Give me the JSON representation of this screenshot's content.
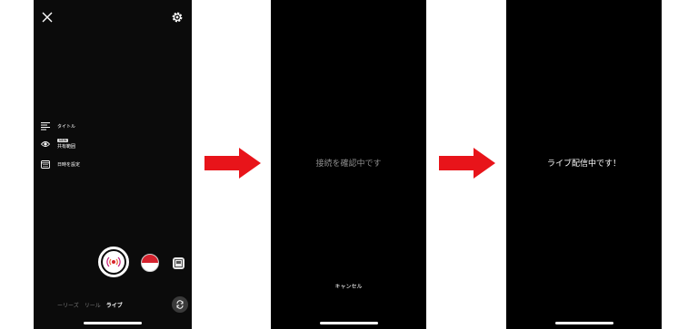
{
  "screen1": {
    "menu": {
      "title": "タイトル",
      "audience_badge": "NEW",
      "audience": "共有範囲",
      "schedule": "日時を設定"
    },
    "modes": [
      "ーリーズ",
      "リール",
      "ライブ"
    ],
    "active_mode": "ライブ",
    "icons": {
      "close": "close-icon",
      "settings": "gear-icon",
      "title": "text-lines-icon",
      "audience": "eye-icon",
      "schedule": "calendar-icon",
      "live": "broadcast-icon",
      "camera_switch": "camera-flip-icon",
      "gallery": "gallery-icon"
    }
  },
  "screen2": {
    "status": "接続を確認中です",
    "cancel": "キャンセル"
  },
  "screen3": {
    "status": "ライブ配信中です！"
  },
  "colors": {
    "arrow": "#e8141a",
    "phone_bg": "#000000",
    "live_accent": "#d5232e"
  }
}
